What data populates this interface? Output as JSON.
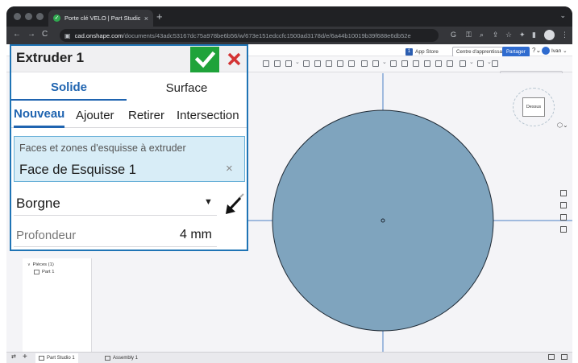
{
  "browser": {
    "tab_title": "Porte clé VELO | Part Studio 1",
    "tab_close": "×",
    "new_tab": "+",
    "tab_menu": "⌄",
    "url_host": "cad.onshape.com",
    "url_path": "/documents/43adc53167dc75a978be6b56/w/673e151edccfc1500ad3178d/e/6a44b10019b39f688e6db52e",
    "nav_back": "←",
    "nav_forward": "→",
    "nav_reload": "C",
    "lock": "🔒"
  },
  "onshape": {
    "appstore_badge": "1",
    "appstore_label": "App Store",
    "learning_label": "Centre d'apprentissage",
    "share_label": "Partager",
    "help_label": "?⌄",
    "user_name": "Ivan ⌄",
    "search_tools_label": "Rechercher des outils...   ⌥ C"
  },
  "view_cube": {
    "label": "Dessus"
  },
  "feature_tree": {
    "parts_label": "Pièces (1)",
    "part_label": "Part 1"
  },
  "bottom_tabs": {
    "part_studio": "Part Studio 1",
    "assembly": "Assembly 1",
    "add": "+"
  },
  "dialog": {
    "title": "Extruder 1",
    "accept_icon": "check-icon",
    "cancel_icon": "close-icon",
    "tab_solide": "Solide",
    "tab_surface": "Surface",
    "op_nouveau": "Nouveau",
    "op_ajouter": "Ajouter",
    "op_retirer": "Retirer",
    "op_intersection": "Intersection",
    "faces_label": "Faces et zones d'esquisse à extruder",
    "faces_value": "Face de Esquisse 1",
    "faces_clear": "×",
    "end_type": "Borgne",
    "end_caret": "▼",
    "depth_label": "Profondeur",
    "depth_value": "4 mm"
  },
  "colors": {
    "accent": "#1f64b0",
    "accept": "#1fa33a",
    "cancel": "#d33333",
    "faces_bg": "#d8edf7",
    "circle_fill": "#7fa4be",
    "axis": "#4d7fc6"
  }
}
